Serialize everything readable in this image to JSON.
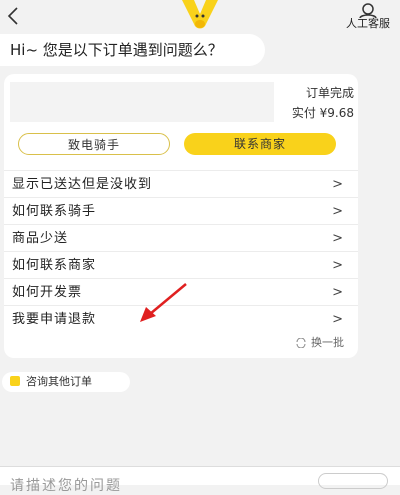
{
  "header": {
    "back_icon": "chevron-left-icon",
    "agent_label": "人工客服"
  },
  "greeting": "Hi~ 您是以下订单遇到问题么？",
  "order": {
    "status": "订单完成",
    "price": "实付 ¥9.68"
  },
  "buttons": {
    "call_rider": "致电骑手",
    "contact_merchant": "联系商家"
  },
  "questions": [
    {
      "label": "显示已送达但是没收到",
      "chevron": ">"
    },
    {
      "label": "如何联系骑手",
      "chevron": ">"
    },
    {
      "label": "商品少送",
      "chevron": ">"
    },
    {
      "label": "如何联系商家",
      "chevron": ">"
    },
    {
      "label": "如何开发票",
      "chevron": ">"
    },
    {
      "label": "我要申请退款",
      "chevron": ">"
    }
  ],
  "refresh_label": "换一批",
  "other_orders_label": "咨询其他订单",
  "bottom": {
    "input_placeholder": "请描述您的问题"
  },
  "colors": {
    "accent": "#f9d21b",
    "arrow": "#e02020",
    "background": "#f2f2f2"
  }
}
